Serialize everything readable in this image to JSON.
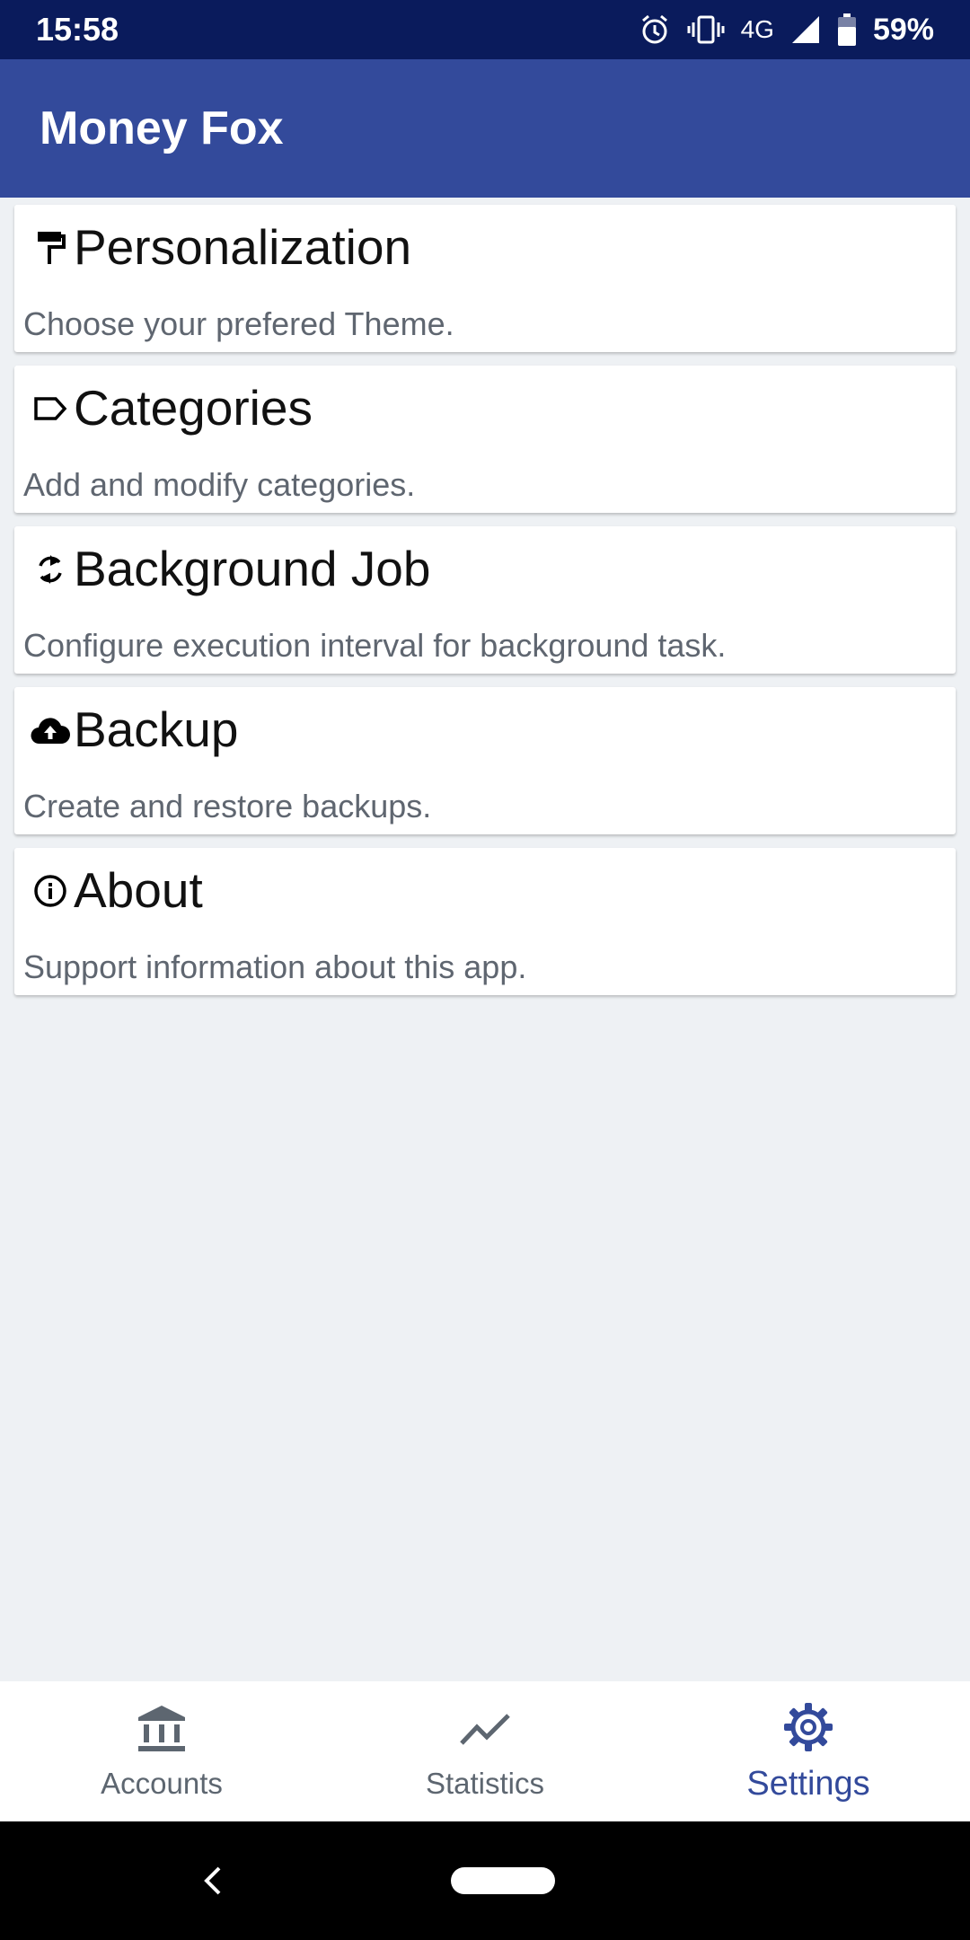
{
  "status_bar": {
    "time": "15:58",
    "network": "4G",
    "battery": "59%",
    "icons": [
      "alarm-icon",
      "vibrate-icon",
      "signal-icon",
      "battery-icon"
    ]
  },
  "app_bar": {
    "title": "Money Fox"
  },
  "settings_items": [
    {
      "title": "Personalization",
      "subtitle": "Choose your prefered Theme.",
      "icon": "paint-roller-icon"
    },
    {
      "title": "Categories",
      "subtitle": "Add and modify categories.",
      "icon": "label-icon"
    },
    {
      "title": "Background Job",
      "subtitle": "Configure execution interval for background task.",
      "icon": "sync-icon"
    },
    {
      "title": "Backup",
      "subtitle": "Create and restore backups.",
      "icon": "cloud-upload-icon"
    },
    {
      "title": "About",
      "subtitle": "Support information about this app.",
      "icon": "info-icon"
    }
  ],
  "bottom_nav": {
    "items": [
      {
        "label": "Accounts",
        "icon": "bank-icon",
        "active": false
      },
      {
        "label": "Statistics",
        "icon": "trending-icon",
        "active": false
      },
      {
        "label": "Settings",
        "icon": "gear-icon",
        "active": true
      }
    ]
  },
  "colors": {
    "status_bar": "#0a1b5c",
    "app_bar": "#334a9b",
    "accent": "#334a9b",
    "background": "#eef1f4"
  }
}
